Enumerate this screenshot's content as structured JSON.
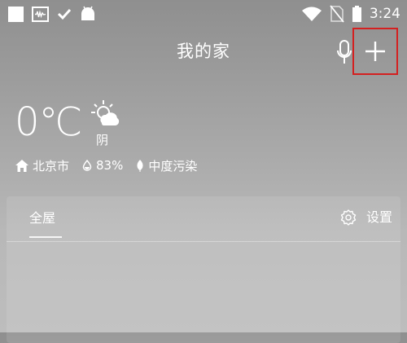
{
  "status_bar": {
    "time": "3:24",
    "icons": [
      "notification-square-icon",
      "voicemail-icon",
      "check-icon",
      "android-icon",
      "wifi-icon",
      "no-sim-icon",
      "battery-icon"
    ]
  },
  "header": {
    "title": "我的家",
    "icons": [
      "microphone-icon",
      "plus-icon"
    ]
  },
  "weather": {
    "temperature": "0℃",
    "condition": "阴",
    "condition_icon": "partly-cloudy-icon",
    "city": "北京市",
    "humidity": "83%",
    "air_quality": "中度污染"
  },
  "card": {
    "tab_label": "全屋",
    "settings_label": "设置"
  },
  "colors": {
    "highlight_border": "#d42020",
    "text": "#ffffff"
  }
}
